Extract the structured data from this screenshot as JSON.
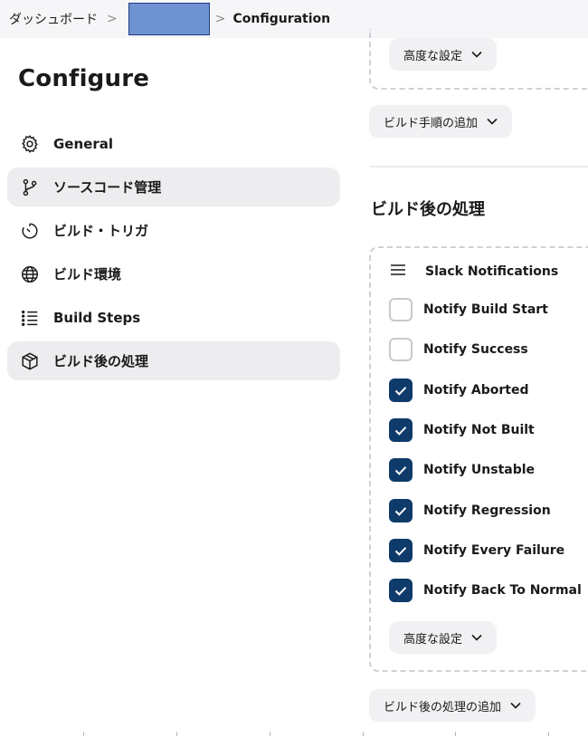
{
  "breadcrumb": {
    "home": "ダッシュボード",
    "separator": ">",
    "current": "Configuration"
  },
  "sidebar": {
    "title": "Configure",
    "items": [
      {
        "label": "General",
        "icon": "gear-icon",
        "active": false
      },
      {
        "label": "ソースコード管理",
        "icon": "branch-icon",
        "active": true
      },
      {
        "label": "ビルド・トリガ",
        "icon": "timer-icon",
        "active": false
      },
      {
        "label": "ビルド環境",
        "icon": "globe-icon",
        "active": false
      },
      {
        "label": "Build Steps",
        "icon": "list-icon",
        "active": false
      },
      {
        "label": "ビルド後の処理",
        "icon": "cube-icon",
        "active": true
      }
    ]
  },
  "main": {
    "advanced_top_label": "高度な設定",
    "add_build_step_label": "ビルド手順の追加",
    "post_build_title": "ビルド後の処理",
    "slack": {
      "title": "Slack Notifications",
      "options": [
        {
          "label": "Notify Build Start",
          "checked": false
        },
        {
          "label": "Notify Success",
          "checked": false
        },
        {
          "label": "Notify Aborted",
          "checked": true
        },
        {
          "label": "Notify Not Built",
          "checked": true
        },
        {
          "label": "Notify Unstable",
          "checked": true
        },
        {
          "label": "Notify Regression",
          "checked": true
        },
        {
          "label": "Notify Every Failure",
          "checked": true
        },
        {
          "label": "Notify Back To Normal",
          "checked": true
        }
      ],
      "advanced_label": "高度な設定"
    },
    "add_post_build_label": "ビルド後の処理の追加"
  },
  "colors": {
    "checkbox_checked": "#0e3b6a",
    "active_nav_bg": "#ededf0",
    "redacted_box": "#6f93d1"
  }
}
